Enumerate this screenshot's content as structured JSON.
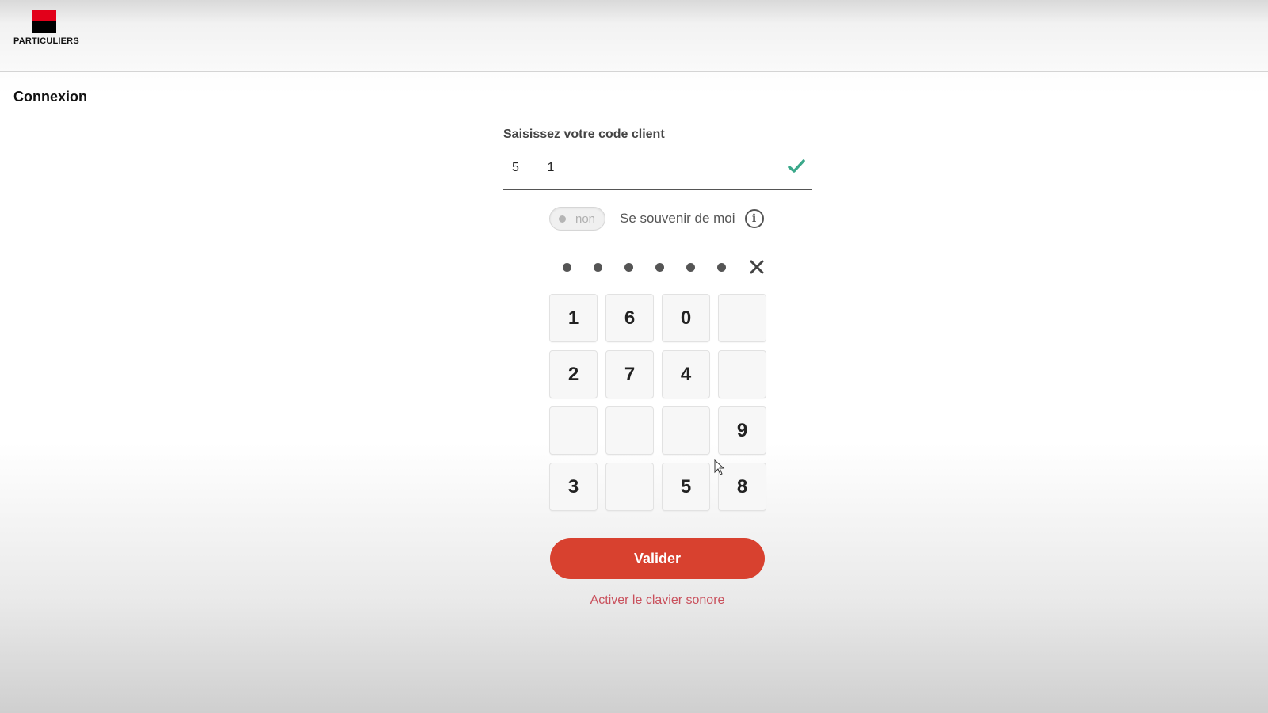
{
  "header": {
    "logo_text": "PARTICULIERS",
    "logo_colors": {
      "top": "#e2001a",
      "bottom": "#000000"
    }
  },
  "page": {
    "title": "Connexion"
  },
  "code_client": {
    "label": "Saisissez votre code client",
    "value": "5        1",
    "status_icon": "check-icon",
    "status_color": "#3aa88a"
  },
  "remember_me": {
    "toggle_state": "non",
    "label": "Se souvenir de moi",
    "info_icon": "info-icon"
  },
  "pin": {
    "filled_count": 6,
    "clear_icon": "close-icon"
  },
  "keypad": {
    "keys": [
      "1",
      "6",
      "0",
      "",
      "2",
      "7",
      "4",
      "",
      "",
      "",
      "",
      "9",
      "3",
      "",
      "5",
      "8"
    ]
  },
  "actions": {
    "validate_label": "Valider",
    "validate_color": "#d8412f",
    "audio_keyboard_link": "Activer le clavier sonore",
    "audio_link_color": "#c9505c"
  }
}
